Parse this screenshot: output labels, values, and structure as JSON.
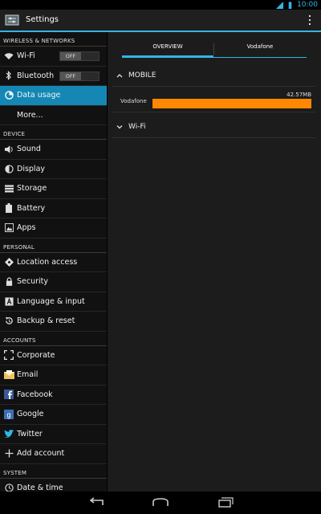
{
  "status_bar": {
    "time": "10:00"
  },
  "action_bar": {
    "title": "Settings"
  },
  "sidebar": {
    "sections": [
      {
        "header": "WIRELESS & NETWORKS",
        "items": [
          {
            "label": "Wi-Fi",
            "icon": "wifi-icon",
            "toggle": "OFF"
          },
          {
            "label": "Bluetooth",
            "icon": "bluetooth-icon",
            "toggle": "OFF"
          },
          {
            "label": "Data usage",
            "icon": "data-usage-icon",
            "active": true
          },
          {
            "label": "More...",
            "icon": ""
          }
        ]
      },
      {
        "header": "DEVICE",
        "items": [
          {
            "label": "Sound",
            "icon": "sound-icon"
          },
          {
            "label": "Display",
            "icon": "display-icon"
          },
          {
            "label": "Storage",
            "icon": "storage-icon"
          },
          {
            "label": "Battery",
            "icon": "battery-icon"
          },
          {
            "label": "Apps",
            "icon": "apps-icon"
          }
        ]
      },
      {
        "header": "PERSONAL",
        "items": [
          {
            "label": "Location access",
            "icon": "location-icon"
          },
          {
            "label": "Security",
            "icon": "lock-icon"
          },
          {
            "label": "Language & input",
            "icon": "language-icon"
          },
          {
            "label": "Backup & reset",
            "icon": "backup-icon"
          }
        ]
      },
      {
        "header": "ACCOUNTS",
        "items": [
          {
            "label": "Corporate",
            "icon": "corporate-icon"
          },
          {
            "label": "Email",
            "icon": "email-icon"
          },
          {
            "label": "Facebook",
            "icon": "facebook-icon"
          },
          {
            "label": "Google",
            "icon": "google-icon"
          },
          {
            "label": "Twitter",
            "icon": "twitter-icon"
          },
          {
            "label": "Add account",
            "icon": "add-icon"
          }
        ]
      },
      {
        "header": "SYSTEM",
        "items": [
          {
            "label": "Date & time",
            "icon": "clock-icon"
          }
        ]
      }
    ]
  },
  "content": {
    "tabs": [
      "OVERVIEW",
      "Vodafone"
    ],
    "mobile": {
      "label": "MOBILE",
      "operator": "Vodafone",
      "amount": "42.57MB",
      "usage_fraction": 1.0
    },
    "wifi": {
      "label": "Wi-Fi"
    }
  },
  "colors": {
    "accent": "#33b5e5",
    "active_item": "#1487b5",
    "usage_bar": "#ff8800"
  }
}
